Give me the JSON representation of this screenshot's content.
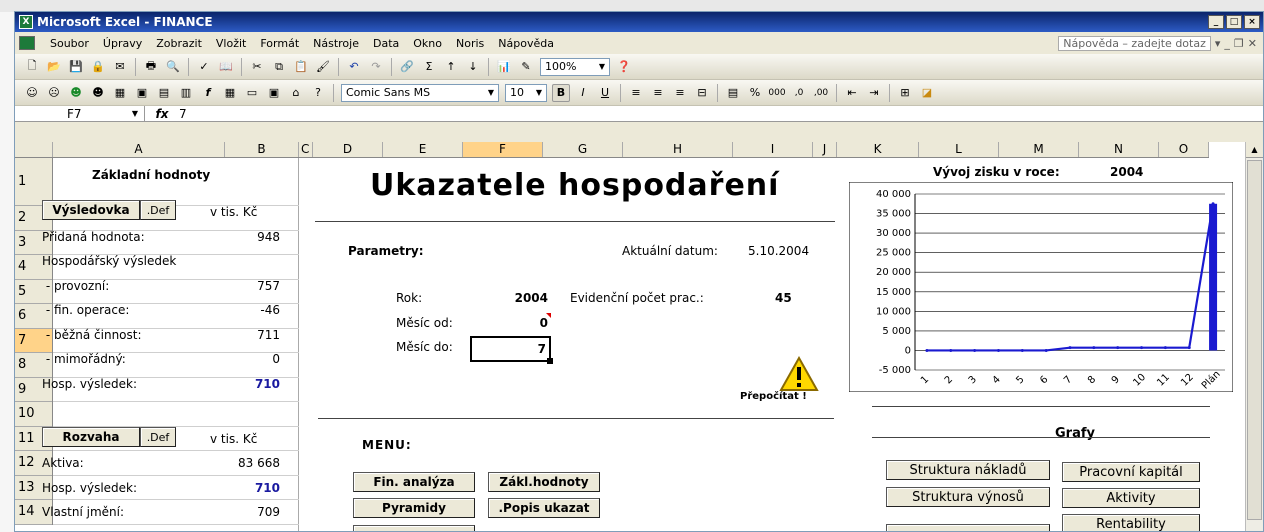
{
  "window": {
    "title": "Microsoft Excel - FINANCE",
    "controls": [
      "_",
      "□",
      "×"
    ]
  },
  "menu": {
    "items": [
      "Soubor",
      "Úpravy",
      "Zobrazit",
      "Vložit",
      "Formát",
      "Nástroje",
      "Data",
      "Okno",
      "Noris",
      "Nápověda"
    ],
    "help_placeholder": "Nápověda – zadejte dotaz"
  },
  "toolbar": {
    "zoom": "100%",
    "font_name": "Comic Sans MS",
    "font_size": "10"
  },
  "formula_bar": {
    "cell_ref": "F7",
    "fx": "fx",
    "value": "7"
  },
  "columns": [
    "A",
    "B",
    "C",
    "D",
    "E",
    "F",
    "G",
    "H",
    "I",
    "J",
    "K",
    "L",
    "M",
    "N",
    "O"
  ],
  "selected_column": "F",
  "rows": [
    "1",
    "2",
    "3",
    "4",
    "5",
    "6",
    "7",
    "8",
    "9",
    "10",
    "11",
    "12",
    "13",
    "14"
  ],
  "selected_row": "7",
  "left_panel": {
    "heading": "Základní hodnoty",
    "vysledovka_btn": "Výsledovka",
    "def_btn": ".Def",
    "unit": "v tis. Kč",
    "items": [
      {
        "label": "Přidaná hodnota:",
        "value": "948"
      },
      {
        "label": "Hospodářský výsledek",
        "value": ""
      },
      {
        "label": " - provozní:",
        "value": "757"
      },
      {
        "label": " - fin. operace:",
        "value": "-46"
      },
      {
        "label": " - běžná činnost:",
        "value": "711"
      },
      {
        "label": " - mimořádný:",
        "value": "0"
      },
      {
        "label": "Hosp. výsledek:",
        "value": "710"
      }
    ],
    "rozvaha_btn": "Rozvaha",
    "rozvaha_items": [
      {
        "label": "Aktiva:",
        "value": "83 668"
      },
      {
        "label": "Hosp. výsledek:",
        "value": "710"
      },
      {
        "label": "Vlastní jmění:",
        "value": "709"
      }
    ]
  },
  "main": {
    "title": "Ukazatele hospodaření",
    "params_label": "Parametry:",
    "date_label": "Aktuální datum:",
    "date_value": "5.10.2004",
    "year_label": "Rok:",
    "year_value": "2004",
    "employees_label": "Evidenční počet prac.:",
    "employees_value": "45",
    "month_from_label": "Měsíc od:",
    "month_from_value": "0",
    "month_to_label": "Měsíc do:",
    "month_to_value": "7",
    "recalc_label": "Přepočítat !",
    "menu_label": "MENU:",
    "buttons": [
      "Fin. analýza",
      "Zákl.hodnoty",
      "Pyramidy",
      ".Popis ukazat"
    ]
  },
  "charts_panel": {
    "label": "Grafy",
    "buttons": [
      "Struktura nákladů",
      "Pracovní kapitál",
      "Struktura výnosů",
      "Aktivity",
      "Rentability"
    ]
  },
  "chart_data": {
    "type": "line",
    "title": "Vývoj zisku v roce:",
    "year": "2004",
    "categories": [
      "1",
      "2",
      "3",
      "4",
      "5",
      "6",
      "7",
      "8",
      "9",
      "10",
      "11",
      "12",
      "Plán"
    ],
    "values": [
      0,
      0,
      0,
      0,
      0,
      0,
      710,
      710,
      710,
      710,
      710,
      710,
      37500
    ],
    "ylim": [
      -5000,
      40000
    ],
    "yticks": [
      "40 000",
      "35 000",
      "30 000",
      "25 000",
      "20 000",
      "15 000",
      "10 000",
      "5 000",
      "0",
      "-5 000"
    ],
    "series_color": "#1a1ad0",
    "grid": true
  }
}
